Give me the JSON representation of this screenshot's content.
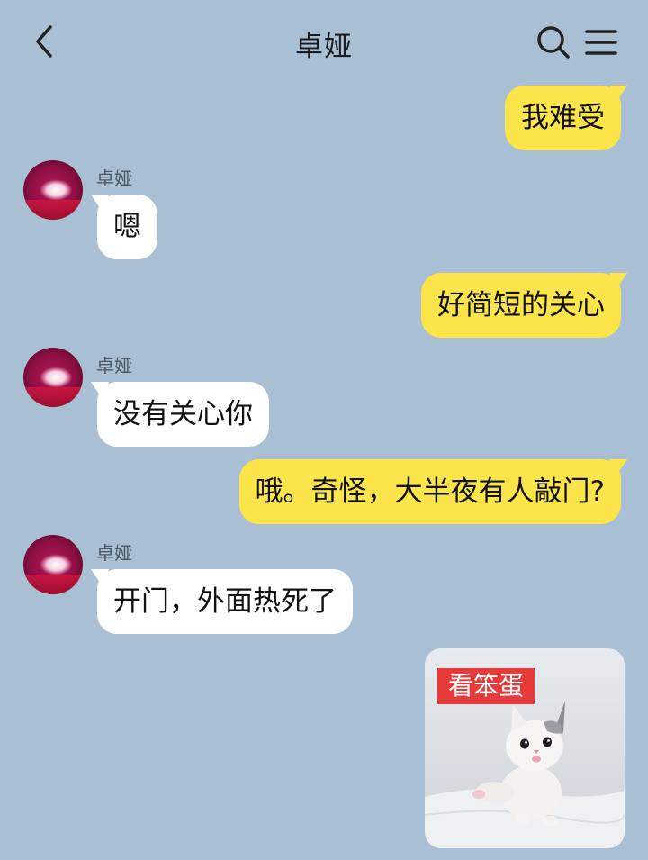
{
  "header": {
    "title": "卓娅",
    "back_icon": "chevron-left-icon",
    "search_icon": "search-icon",
    "menu_icon": "menu-icon"
  },
  "colors": {
    "background": "#a9bfd3",
    "outgoing_bubble": "#fbe54a",
    "incoming_bubble": "#ffffff",
    "sticker_caption_bg": "#e53b3b"
  },
  "messages": [
    {
      "direction": "out",
      "text": "我难受"
    },
    {
      "direction": "in",
      "sender": "卓娅",
      "text": "嗯"
    },
    {
      "direction": "out",
      "text": "好简短的关心"
    },
    {
      "direction": "in",
      "sender": "卓娅",
      "text": "没有关心你"
    },
    {
      "direction": "out",
      "text": "哦。奇怪，大半夜有人敲门?"
    },
    {
      "direction": "in",
      "sender": "卓娅",
      "text": "开门，外面热死了"
    },
    {
      "direction": "out",
      "type": "sticker",
      "caption": "看笨蛋",
      "image": "white kitten sticker"
    }
  ]
}
